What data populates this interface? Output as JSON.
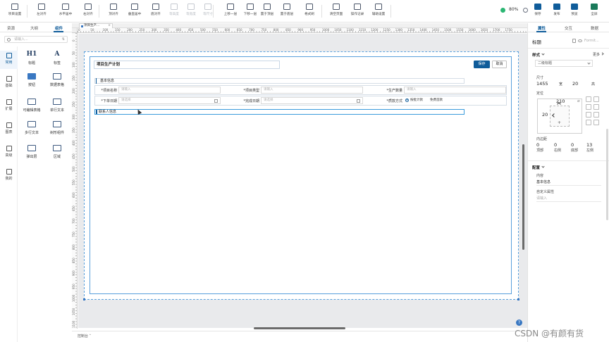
{
  "toolbar": {
    "items": [
      {
        "label": "项目设置",
        "disabled": false
      },
      {
        "label": "左对齐",
        "disabled": false
      },
      {
        "label": "水平居中",
        "disabled": false
      },
      {
        "label": "右对齐",
        "disabled": false
      },
      {
        "label": "顶对齐",
        "disabled": false
      },
      {
        "label": "垂直居中",
        "disabled": false
      },
      {
        "label": "底对齐",
        "disabled": false
      },
      {
        "label": "等高度",
        "disabled": true
      },
      {
        "label": "等宽度",
        "disabled": true
      },
      {
        "label": "等尺寸",
        "disabled": true
      },
      {
        "label": "上移一层",
        "disabled": false
      },
      {
        "label": "下移一层",
        "disabled": false
      },
      {
        "label": "置于顶层",
        "disabled": false
      },
      {
        "label": "置于底层",
        "disabled": false
      },
      {
        "label": "格式刷",
        "disabled": false
      },
      {
        "label": "清空页面",
        "disabled": false
      },
      {
        "label": "操作记录",
        "disabled": false
      },
      {
        "label": "辅助设置",
        "disabled": false
      }
    ],
    "zoom": "80%",
    "right": [
      {
        "label": "保存",
        "style": "primary"
      },
      {
        "label": "发布",
        "style": "primary"
      },
      {
        "label": "预览",
        "style": "primary"
      },
      {
        "label": "全屏",
        "style": "green"
      }
    ]
  },
  "left_panel": {
    "tabs": [
      "资源",
      "大纲",
      "组件"
    ],
    "active_tab": "组件",
    "search_placeholder": "请输入...",
    "categories": [
      {
        "label": "常用",
        "icon": "star-icon",
        "active": true
      },
      {
        "label": "基础",
        "icon": "grid-icon",
        "active": false
      },
      {
        "label": "扩展",
        "icon": "layers-icon",
        "active": false
      },
      {
        "label": "图表",
        "icon": "chart-icon",
        "active": false
      },
      {
        "label": "高级",
        "icon": "diamond-icon",
        "active": false
      },
      {
        "label": "我的",
        "icon": "user-icon",
        "active": false
      }
    ],
    "components": [
      {
        "label": "标题",
        "glyph": "H1",
        "kind": "glyph"
      },
      {
        "label": "标签",
        "glyph": "A",
        "kind": "glyph"
      },
      {
        "label": "按钮",
        "kind": "blue"
      },
      {
        "label": "数据表格",
        "kind": "table"
      },
      {
        "label": "可编辑表格",
        "kind": "box"
      },
      {
        "label": "单行文本",
        "kind": "box"
      },
      {
        "label": "多行文本",
        "kind": "box"
      },
      {
        "label": "树形组件",
        "kind": "box"
      },
      {
        "label": "弹出层",
        "kind": "box"
      },
      {
        "label": "区域",
        "kind": "box"
      }
    ]
  },
  "canvas": {
    "tab_label": "项目生产...",
    "ruler_marks": [
      "0",
      "50",
      "100",
      "150",
      "200",
      "250",
      "300",
      "350",
      "400",
      "450",
      "500",
      "550",
      "600",
      "650",
      "700",
      "750",
      "800",
      "850",
      "900",
      "950",
      "1000",
      "1050",
      "1100",
      "1150",
      "1200",
      "1250",
      "1300",
      "1350",
      "1400",
      "1450",
      "1500",
      "1550",
      "1600",
      "1650",
      "1700",
      "1750"
    ],
    "ruler_v_marks": [
      "0",
      "50",
      "100",
      "150",
      "200",
      "250",
      "300",
      "350",
      "400",
      "450",
      "500",
      "550",
      "600",
      "650",
      "700",
      "750",
      "800",
      "850",
      "900",
      "950",
      "1000",
      "1050",
      "1100"
    ],
    "bottom_label": "控制台"
  },
  "form": {
    "title": "项目生产计划",
    "save": "保存",
    "cancel": "取消",
    "section1": "基本信息",
    "fields": [
      {
        "label": "*项目名称",
        "placeholder": "请输入",
        "calendar": false
      },
      {
        "label": "*项目类型",
        "placeholder": "请输入",
        "calendar": false
      },
      {
        "label": "*生产数量",
        "placeholder": "请输入",
        "calendar": false
      },
      {
        "label": "*下单日期",
        "placeholder": "请选择",
        "calendar": true
      },
      {
        "label": "*完成日期",
        "placeholder": "请选择",
        "calendar": true
      }
    ],
    "radio_label": "*质款方式",
    "radios": [
      {
        "label": "按批计款",
        "checked": true
      },
      {
        "label": "免费首款",
        "checked": false
      }
    ],
    "section2": "联系人信息"
  },
  "right_panel": {
    "tabs": [
      "属性",
      "交互",
      "数据"
    ],
    "active_tab": "属性",
    "component_name": "标题",
    "search_placeholder": "Formit...",
    "style_head": "样式",
    "more": "更多",
    "style_value": "二级标题",
    "size_head": "尺寸",
    "width": "1455",
    "width_label": "宽",
    "height": "20",
    "height_label": "高",
    "position_head": "定位",
    "pos_top": "210",
    "pos_left": "20",
    "padding_head": "内边距",
    "paddings": [
      {
        "value": "0",
        "label": "顶部"
      },
      {
        "value": "0",
        "label": "右侧"
      },
      {
        "value": "0",
        "label": "底部"
      },
      {
        "value": "13",
        "label": "左侧"
      }
    ],
    "config_head": "配置",
    "content_label": "内容",
    "content_value": "基本信息",
    "custom_label": "自定义属性",
    "custom_placeholder": "请输入"
  },
  "watermark": "CSDN @有颜有货"
}
